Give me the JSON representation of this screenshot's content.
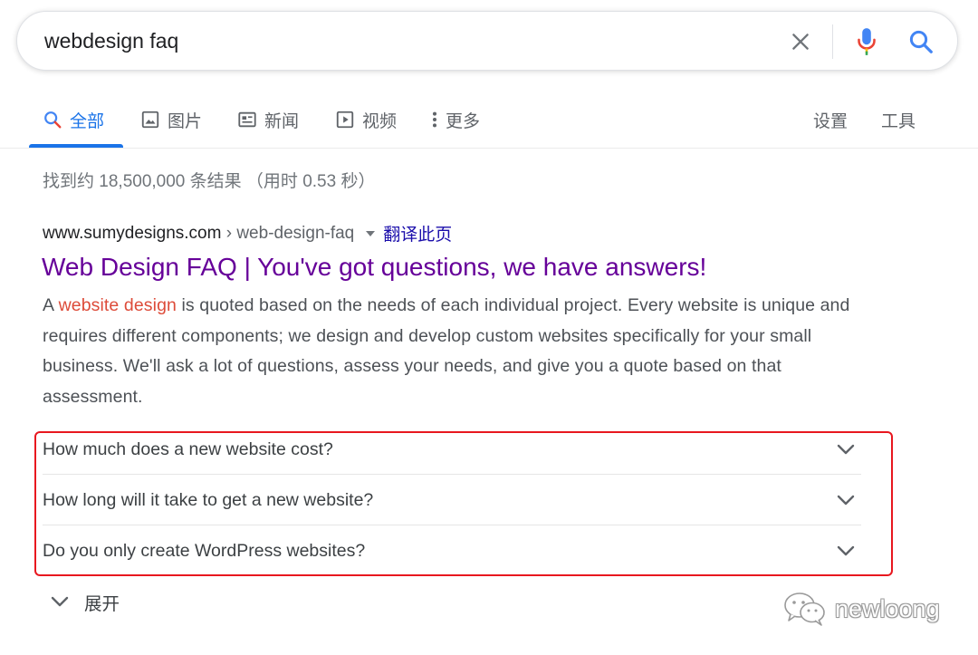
{
  "search": {
    "query": "webdesign faq",
    "icons": {
      "clear": "close-icon",
      "voice": "mic-icon",
      "search": "search-icon"
    }
  },
  "tabs": [
    {
      "label": "全部",
      "icon": "search-icon",
      "active": true
    },
    {
      "label": "图片",
      "icon": "image-icon",
      "active": false
    },
    {
      "label": "新闻",
      "icon": "news-icon",
      "active": false
    },
    {
      "label": "视频",
      "icon": "video-icon",
      "active": false
    },
    {
      "label": "更多",
      "icon": "more-vert-icon",
      "active": false
    }
  ],
  "tools": {
    "settings_label": "设置",
    "tools_label": "工具"
  },
  "stats": "找到约 18,500,000 条结果 （用时 0.53 秒）",
  "result": {
    "site": "www.sumydesigns.com",
    "path": "› web-design-faq",
    "translate_label": "翻译此页",
    "title": "Web Design FAQ | You've got questions, we have answers!",
    "snippet_prefix": "A ",
    "snippet_highlight": "website design",
    "snippet_rest": " is quoted based on the needs of each individual project. Every website is unique and requires different components; we design and develop custom websites specifically for your small business. We'll ask a lot of questions, assess your needs, and give you a quote based on that assessment."
  },
  "faq": [
    {
      "question": "How much does a new website cost?"
    },
    {
      "question": "How long will it take to get a new website?"
    },
    {
      "question": "Do you only create WordPress websites?"
    }
  ],
  "expand_label": "展开",
  "watermark": {
    "text": "newloong",
    "icon": "wechat-icon"
  },
  "colors": {
    "accent_blue": "#1a73e8",
    "visited_link": "#660099",
    "link": "#1a0dab",
    "highlight": "#dd4b39",
    "annotation_border": "#e8171f"
  }
}
